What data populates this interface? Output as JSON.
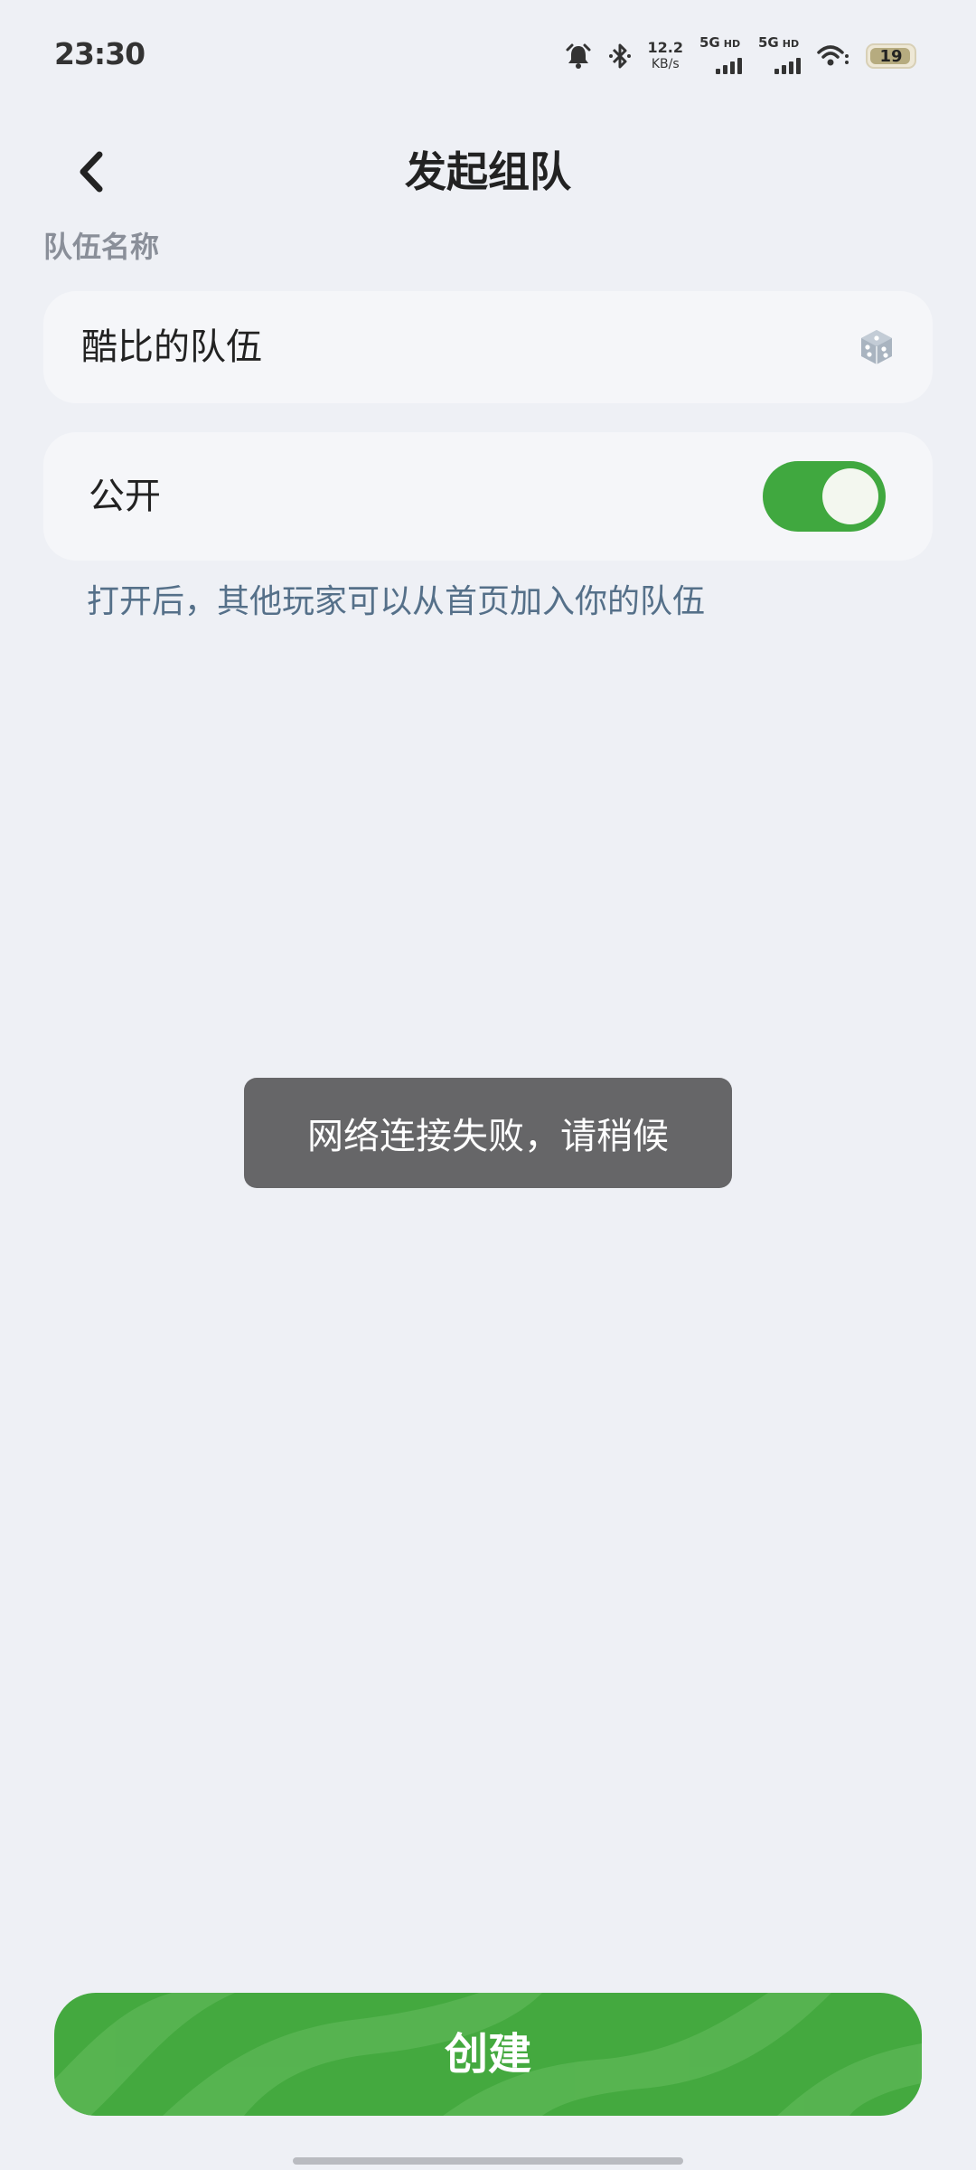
{
  "status_bar": {
    "time": "23:30",
    "net_speed_value": "12.2",
    "net_speed_unit": "KB/s",
    "sim1": "5G",
    "sim1_hd": "HD",
    "sim2": "5G",
    "sim2_hd": "HD",
    "battery_level": "19"
  },
  "header": {
    "title": "发起组队"
  },
  "team_name": {
    "label": "队伍名称",
    "value": "酷比的队伍"
  },
  "public_setting": {
    "label": "公开",
    "enabled": true,
    "hint": "打开后，其他玩家可以从首页加入你的队伍"
  },
  "toast": {
    "message": "网络连接失败，请稍候"
  },
  "create_button": {
    "label": "创建"
  },
  "colors": {
    "background": "#eef0f5",
    "accent_green": "#44a93f",
    "hint_text": "#557089",
    "toast_bg": "#666668"
  },
  "icons": {
    "back": "chevron-left-icon",
    "dice": "dice-icon"
  }
}
